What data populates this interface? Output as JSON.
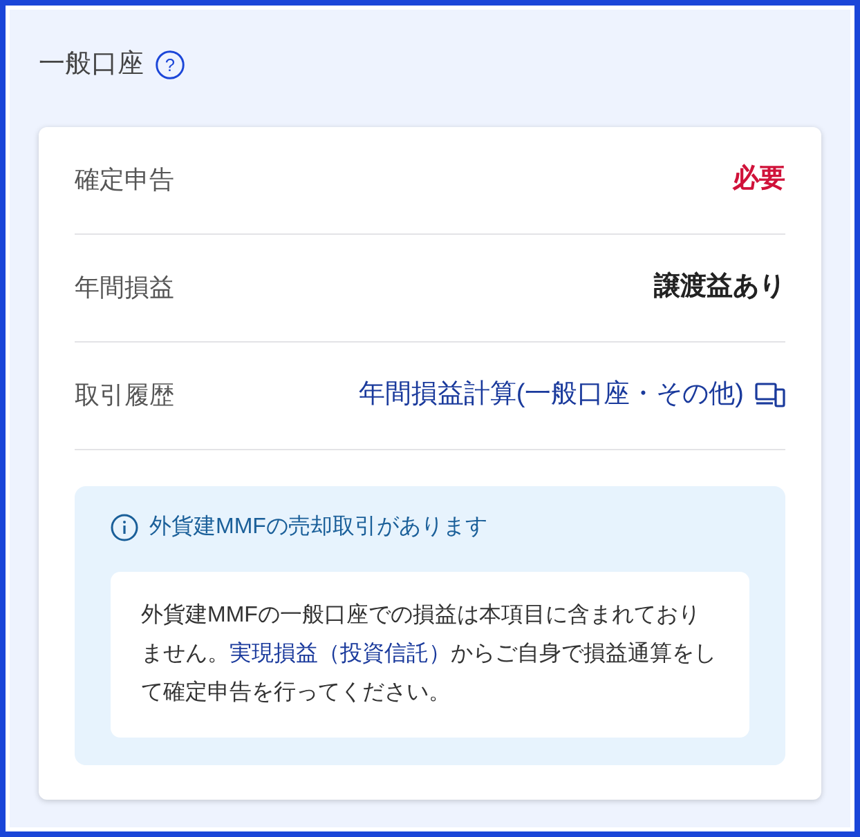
{
  "section": {
    "title": "一般口座",
    "help": "?"
  },
  "rows": [
    {
      "label": "確定申告",
      "kind": "alert",
      "value": "必要"
    },
    {
      "label": "年間損益",
      "kind": "strong",
      "value": "譲渡益あり"
    },
    {
      "label": "取引履歴",
      "kind": "link",
      "value": "年間損益計算(一般口座・その他)"
    }
  ],
  "notice": {
    "title": "外貨建MMFの売却取引があります",
    "body": [
      {
        "kind": "text",
        "text": "外貨建MMFの一般口座での損益は本項目に含まれておりません。"
      },
      {
        "kind": "link",
        "text": "実現損益（投資信託）"
      },
      {
        "kind": "text",
        "text": "からご自身で損益通算をして確定申告を行ってください。"
      }
    ]
  }
}
